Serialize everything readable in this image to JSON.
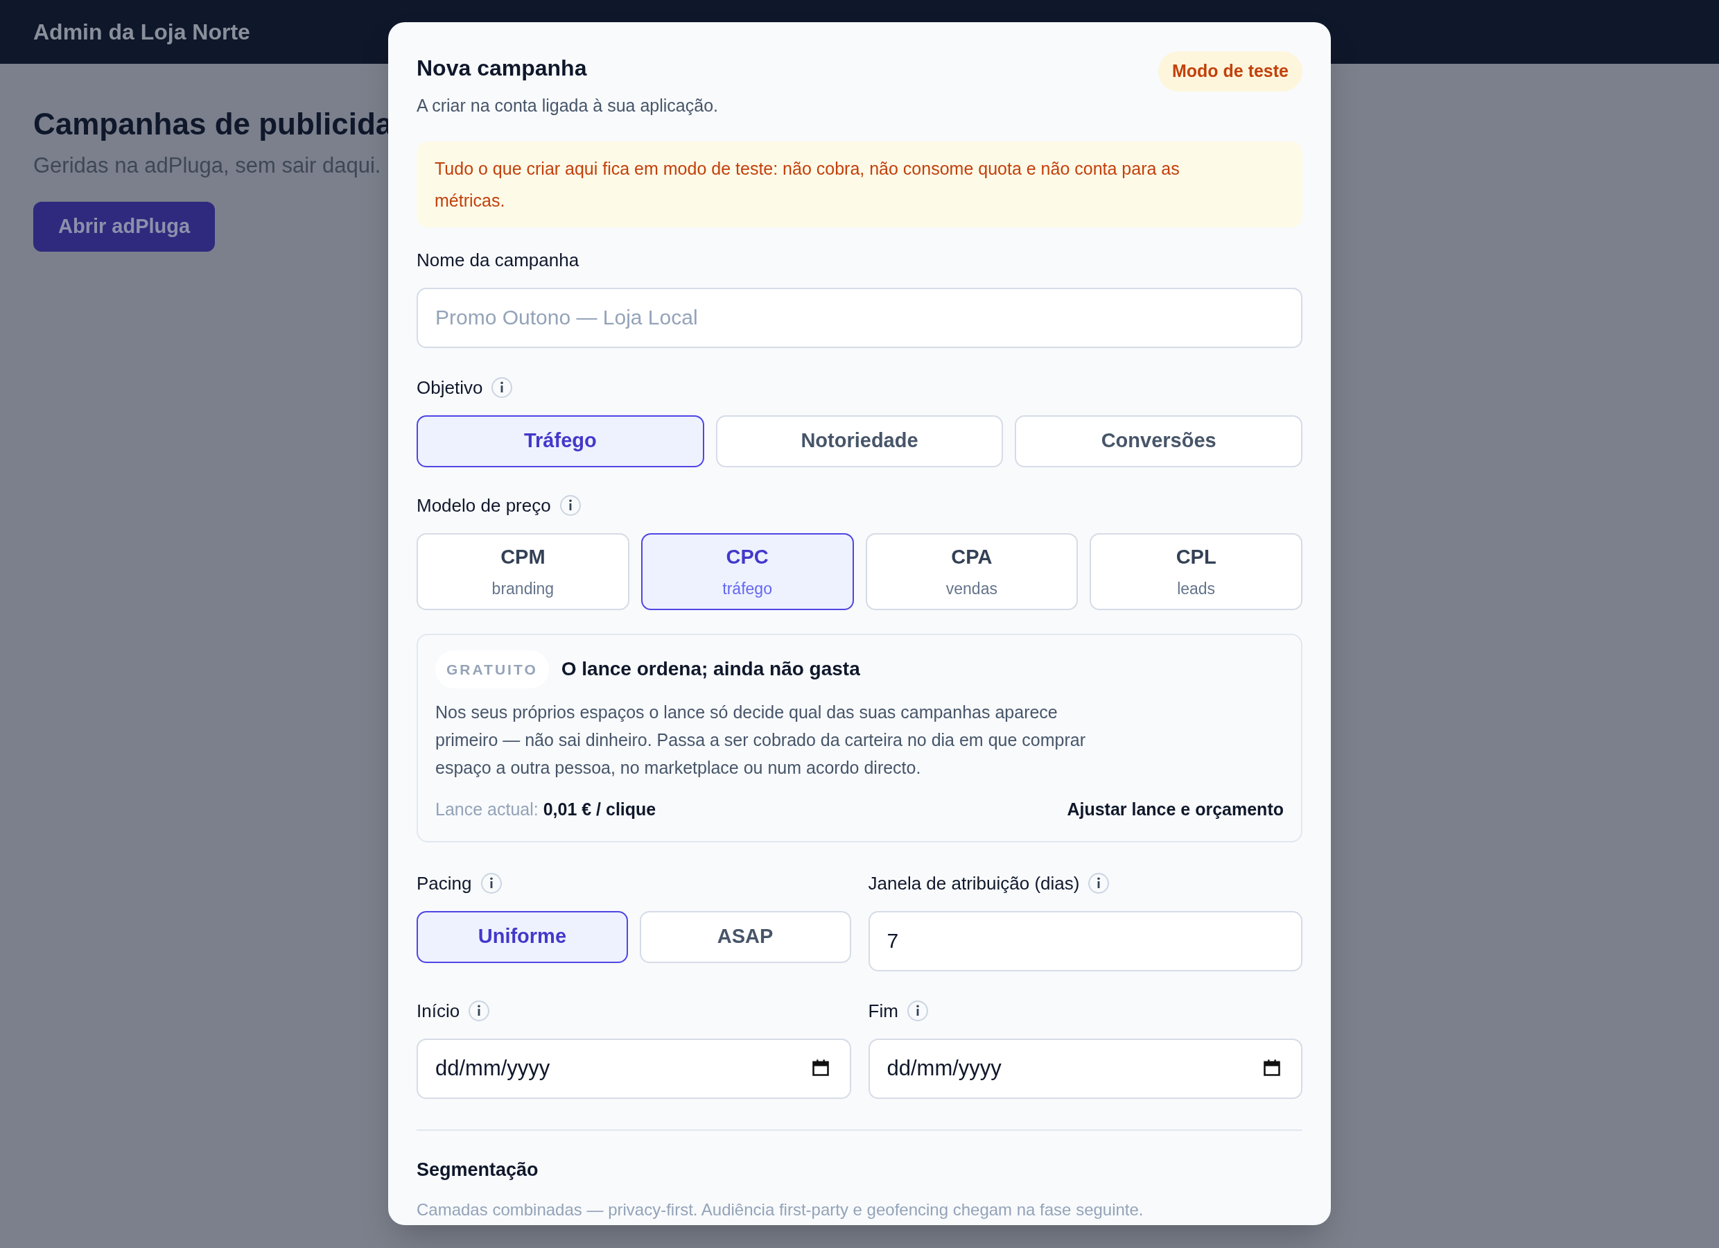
{
  "background": {
    "header_title": "Admin da Loja Norte",
    "heading": "Campanhas de publicida",
    "subheading": "Geridas na adPluga, sem sair daqui.",
    "button": "Abrir adPluga"
  },
  "modal": {
    "title": "Nova campanha",
    "subtitle": "A criar na conta ligada à sua aplicação.",
    "badge": "Modo de teste",
    "alert": "Tudo o que criar aqui fica em modo de teste: não cobra, não consome quota e não conta para as métricas.",
    "name_field": {
      "label": "Nome da campanha",
      "placeholder": "Promo Outono — Loja Local"
    },
    "objective": {
      "label": "Objetivo",
      "options": [
        {
          "label": "Tráfego",
          "selected": true
        },
        {
          "label": "Notoriedade",
          "selected": false
        },
        {
          "label": "Conversões",
          "selected": false
        }
      ]
    },
    "pricing": {
      "label": "Modelo de preço",
      "options": [
        {
          "label": "CPM",
          "sub": "branding",
          "selected": false
        },
        {
          "label": "CPC",
          "sub": "tráfego",
          "selected": true
        },
        {
          "label": "CPA",
          "sub": "vendas",
          "selected": false
        },
        {
          "label": "CPL",
          "sub": "leads",
          "selected": false
        }
      ]
    },
    "info": {
      "badge": "GRATUITO",
      "title": "O lance ordena; ainda não gasta",
      "body": "Nos seus próprios espaços o lance só decide qual das suas campanhas aparece primeiro — não sai dinheiro. Passa a ser cobrado da carteira no dia em que comprar espaço a outra pessoa, no marketplace ou num acordo directo.",
      "bid_label": "Lance actual:",
      "bid_value": "0,01 € / clique",
      "link": "Ajustar lance e orçamento"
    },
    "pacing": {
      "label": "Pacing",
      "options": [
        {
          "label": "Uniforme",
          "selected": true
        },
        {
          "label": "ASAP",
          "selected": false
        }
      ]
    },
    "attribution": {
      "label": "Janela de atribuição (dias)",
      "value": "7"
    },
    "start": {
      "label": "Início",
      "placeholder": "dd/mm/yyyy"
    },
    "end": {
      "label": "Fim",
      "placeholder": "dd/mm/yyyy"
    },
    "segmentation": {
      "title": "Segmentação",
      "description": "Camadas combinadas — privacy-first. Audiência first-party e geofencing chegam na fase seguinte."
    }
  }
}
